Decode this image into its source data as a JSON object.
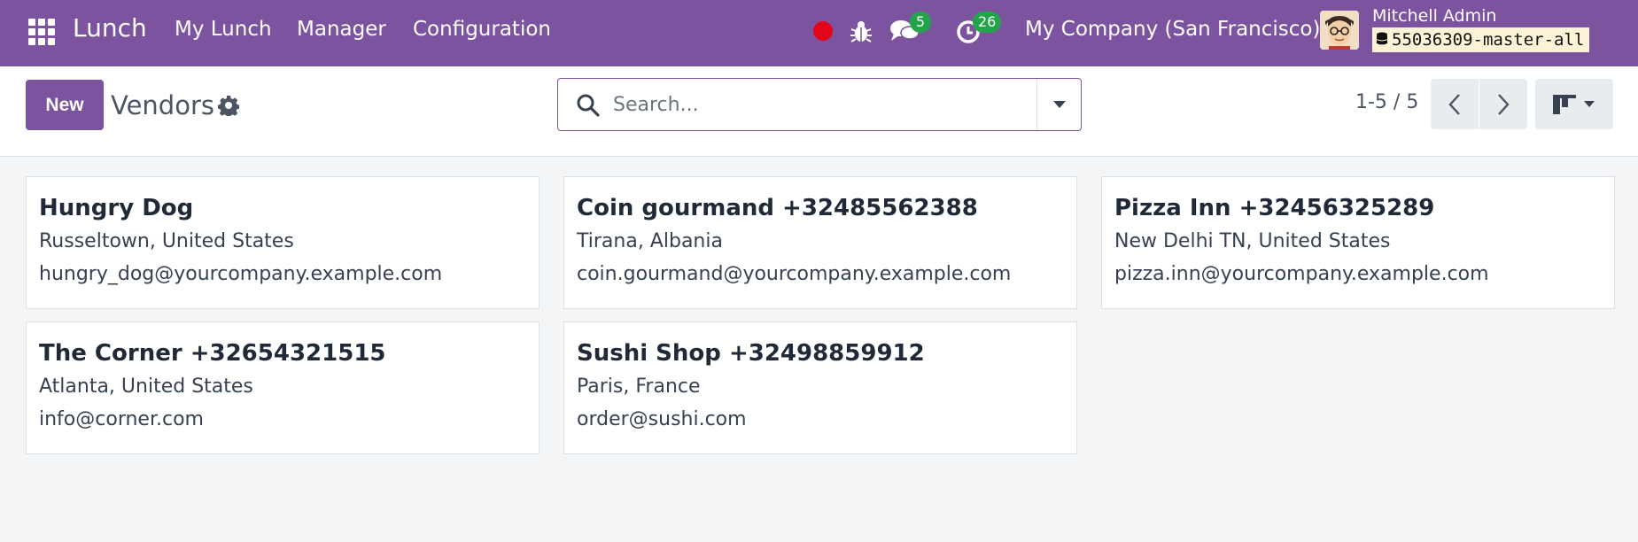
{
  "navbar": {
    "app_name": "Lunch",
    "menu": [
      "My Lunch",
      "Manager",
      "Configuration"
    ],
    "messages_count": "5",
    "activities_count": "26",
    "company": "My Company (San Francisco)",
    "user_name": "Mitchell Admin",
    "database": "55036309-master-all",
    "colors": {
      "brand": "#7b539f",
      "badge": "#22a44a",
      "record": "#e3051a"
    }
  },
  "control": {
    "new_label": "New",
    "title": "Vendors",
    "search_placeholder": "Search...",
    "pager": "1-5 / 5"
  },
  "vendors": [
    {
      "name": "Hungry Dog",
      "location": "Russeltown, United States",
      "email": "hungry_dog@yourcompany.example.com"
    },
    {
      "name": "Coin gourmand +32485562388",
      "location": "Tirana, Albania",
      "email": "coin.gourmand@yourcompany.example.com"
    },
    {
      "name": "Pizza Inn +32456325289",
      "location": "New Delhi TN, United States",
      "email": "pizza.inn@yourcompany.example.com"
    },
    {
      "name": "The Corner +32654321515",
      "location": "Atlanta, United States",
      "email": "info@corner.com"
    },
    {
      "name": "Sushi Shop +32498859912",
      "location": "Paris, France",
      "email": "order@sushi.com"
    }
  ]
}
